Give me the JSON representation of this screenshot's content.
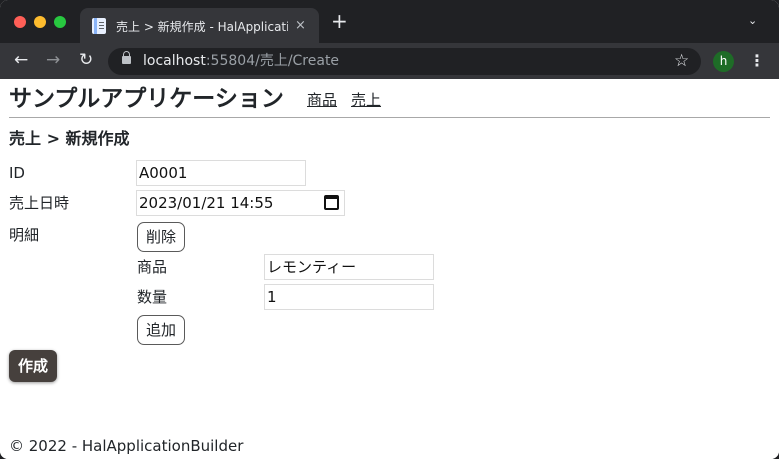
{
  "browser": {
    "tab_title": "売上 > 新規作成 - HalApplicatio",
    "tab_close": "×",
    "new_tab": "+",
    "tab_menu": "⌄",
    "back": "←",
    "forward": "→",
    "reload": "↻",
    "url_host": "localhost",
    "url_path": ":55804/売上/Create",
    "bookmark": "☆",
    "profile_initial": "h",
    "menu": "⋮"
  },
  "header": {
    "brand": "サンプルアプリケーション",
    "nav": [
      "商品",
      "売上"
    ]
  },
  "form": {
    "heading": "売上 > 新規作成",
    "id_label": "ID",
    "id_value": "A0001",
    "date_label": "売上日時",
    "date_value": "2023/01/21 14:55",
    "detail_label": "明細",
    "delete_button": "削除",
    "product_label": "商品",
    "product_value": "レモンティー",
    "quantity_label": "数量",
    "quantity_value": "1",
    "add_button": "追加",
    "create_button": "作成"
  },
  "footer": {
    "text": "© 2022 - HalApplicationBuilder"
  }
}
